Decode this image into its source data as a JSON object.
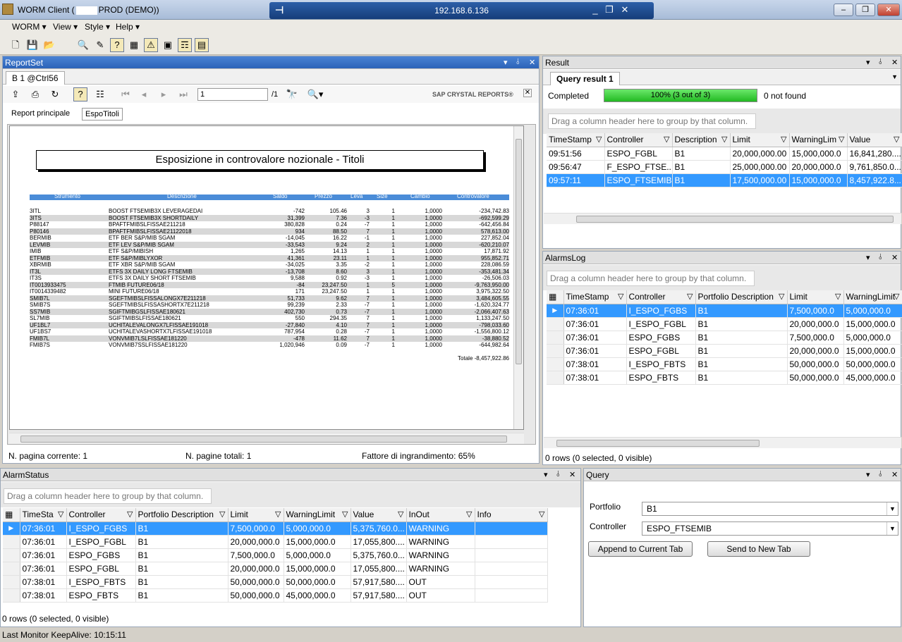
{
  "window": {
    "title": "WORM Client (",
    "title_suffix": "PROD (DEMO))",
    "rdp_ip": "192.168.6.136"
  },
  "menu": [
    "WORM",
    "View",
    "Style",
    "Help"
  ],
  "reportset": {
    "title": "ReportSet",
    "tab": "B 1 @Ctrl56",
    "page_input": "1",
    "page_total": "/1",
    "brand": "SAP CRYSTAL REPORTS®",
    "subtabs": [
      "Report principale",
      "EspoTitoli"
    ],
    "report_title": "Esposizione in controvalore nozionale    - Titoli",
    "columns": [
      "Strumento",
      "Descrizione",
      "Saldo",
      "Prezzo",
      "Leva",
      "Size",
      "Cambio",
      "Controvalore"
    ],
    "rows": [
      [
        "3ITL",
        "BOOST FTSEMIB3X LEVERAGEDAI",
        "-742",
        "105.46",
        "3",
        "1",
        "1,0000",
        "-234,742.83"
      ],
      [
        "3ITS",
        "BOOST FTSEMIB3X SHORTDAILY",
        "31,399",
        "7.36",
        "-3",
        "1",
        "1,0000",
        "-692,599.29"
      ],
      [
        "P88147",
        "BPAFTFMIBSLFISSAE211218",
        "380,828",
        "0.24",
        "-7",
        "1",
        "1,0000",
        "-642,456.84"
      ],
      [
        "P80146",
        "BPAFTFMIBSLFISSAE21122018",
        "934",
        "88.50",
        "7",
        "1",
        "1,0000",
        "578,613.00"
      ],
      [
        "BERMIB",
        "ETF BER S&P/MIB SGAM",
        "-14,045",
        "16.22",
        "-1",
        "1",
        "1,0000",
        "227,852.04"
      ],
      [
        "LEVMIB",
        "ETF LEV S&P/MIB SGAM",
        "-33,543",
        "9.24",
        "2",
        "1",
        "1,0000",
        "-620,210.07"
      ],
      [
        "IMIB",
        "ETF S&P/MIBISH",
        "1,265",
        "14.13",
        "1",
        "1",
        "1,0000",
        "17,871.92"
      ],
      [
        "ETFMIB",
        "ETF S&P/MIBLYXOR",
        "41,361",
        "23.11",
        "1",
        "1",
        "1,0000",
        "955,852.71"
      ],
      [
        "XBRMIB",
        "ETF XBR S&P/MIB SGAM",
        "-34,025",
        "3.35",
        "-2",
        "1",
        "1,0000",
        "228,086.59"
      ],
      [
        "IT3L",
        "ETFS 3X DAILY LONG FTSEMIB",
        "-13,708",
        "8.60",
        "3",
        "1",
        "1,0000",
        "-353,481.34"
      ],
      [
        "IT3S",
        "ETFS 3X DAILY SHORT FTSEMIB",
        "9,588",
        "0.92",
        "-3",
        "1",
        "1,0000",
        "-26,506.03"
      ],
      [
        "IT0013933475",
        "FTMIB FUTURE06/18",
        "-84",
        "23,247.50",
        "1",
        "5",
        "1,0000",
        "-9,763,950.00"
      ],
      [
        "IT0014339482",
        "MINI FUTURE06/18",
        "171",
        "23,247.50",
        "1",
        "1",
        "1,0000",
        "3,975,322.50"
      ],
      [
        "SMIB7L",
        "SGEFTMIBSLFISSALONGX7E211218",
        "51,733",
        "9.62",
        "7",
        "1",
        "1,0000",
        "3,484,605.55"
      ],
      [
        "SMIB7S",
        "SGEFTMIBSLFISSASHORTX7E211218",
        "99,239",
        "2.33",
        "-7",
        "1",
        "1,0000",
        "-1,620,324.77"
      ],
      [
        "SS7MIB",
        "SGIFTMIBGSLFISSAE180621",
        "402,730",
        "0.73",
        "-7",
        "1",
        "1,0000",
        "-2,066,407.63"
      ],
      [
        "SL7MIB",
        "SGIFTMIBSLFISSAE180621",
        "550",
        "294.35",
        "7",
        "1",
        "1,0000",
        "1,133,247.50"
      ],
      [
        "UF1BL7",
        "UCHITALEVALONGX7LFISSAE191018",
        "-27,840",
        "4.10",
        "7",
        "1",
        "1,0000",
        "-798,033.60"
      ],
      [
        "UF1BS7",
        "UCHITALEVASHORTX7LFISSAE191018",
        "787,954",
        "0.28",
        "-7",
        "1",
        "1,0000",
        "-1,556,800.12"
      ],
      [
        "FMIB7L",
        "VONVMIB7LSLFISSAE181220",
        "-478",
        "11.62",
        "7",
        "1",
        "1,0000",
        "-38,880.52"
      ],
      [
        "FMIB7S",
        "VONVMIB7SSLFISSAE181220",
        "1,020,946",
        "0.09",
        "-7",
        "1",
        "1,0000",
        "-644,982.64"
      ]
    ],
    "total": "Totale -8,457,922.86",
    "status": {
      "page": "N. pagina corrente: 1",
      "pages": "N. pagine totali: 1",
      "zoom": "Fattore di ingrandimento: 65%"
    }
  },
  "result": {
    "title": "Result",
    "tab": "Query result 1",
    "completed": "Completed",
    "progress": "100% (3 out of 3)",
    "progress_value": 1.0,
    "not_found": "0 not found",
    "group_hint": "Drag a column header here to group by that column.",
    "columns": [
      "TimeStamp",
      "Controller",
      "Description",
      "Limit",
      "WarningLim",
      "Value"
    ],
    "rows": [
      [
        "09:51:56",
        "ESPO_FGBL",
        "B1",
        "20,000,000.00",
        "15,000,000.0",
        "16,841,280...."
      ],
      [
        "09:56:47",
        "F_ESPO_FTSE...",
        "B1",
        "25,000,000.00",
        "20,000,000.0",
        "9,761,850.0..."
      ],
      [
        "09:57:11",
        "ESPO_FTSEMIB",
        "B1",
        "17,500,000.00",
        "15,000,000.0",
        "8,457,922.8..."
      ]
    ]
  },
  "alarmslog": {
    "title": "AlarmsLog",
    "group_hint": "Drag a column header here to group by that column.",
    "columns": [
      "TimeStamp",
      "Controller",
      "Portfolio Description",
      "Limit",
      "WarningLimit"
    ],
    "rows": [
      [
        "07:36:01",
        "I_ESPO_FGBS",
        "B1",
        "7,500,000.0",
        "5,000,000.0"
      ],
      [
        "07:36:01",
        "I_ESPO_FGBL",
        "B1",
        "20,000,000.0",
        "15,000,000.0"
      ],
      [
        "07:36:01",
        "ESPO_FGBS",
        "B1",
        "7,500,000.0",
        "5,000,000.0"
      ],
      [
        "07:36:01",
        "ESPO_FGBL",
        "B1",
        "20,000,000.0",
        "15,000,000.0"
      ],
      [
        "07:38:01",
        "I_ESPO_FBTS",
        "B1",
        "50,000,000.0",
        "50,000,000.0"
      ],
      [
        "07:38:01",
        "ESPO_FBTS",
        "B1",
        "50,000,000.0",
        "45,000,000.0"
      ]
    ],
    "status": "0 rows (0 selected, 0 visible)"
  },
  "alarmstatus": {
    "title": "AlarmStatus",
    "group_hint": "Drag a column header here to group by that column.",
    "columns": [
      "TimeSta",
      "Controller",
      "Portfolio Description",
      "Limit",
      "WarningLimit",
      "Value",
      "InOut",
      "Info"
    ],
    "rows": [
      [
        "07:36:01",
        "I_ESPO_FGBS",
        "B1",
        "7,500,000.0",
        "5,000,000.0",
        "5,375,760.0...",
        "WARNING",
        ""
      ],
      [
        "07:36:01",
        "I_ESPO_FGBL",
        "B1",
        "20,000,000.0",
        "15,000,000.0",
        "17,055,800....",
        "WARNING",
        ""
      ],
      [
        "07:36:01",
        "ESPO_FGBS",
        "B1",
        "7,500,000.0",
        "5,000,000.0",
        "5,375,760.0...",
        "WARNING",
        ""
      ],
      [
        "07:36:01",
        "ESPO_FGBL",
        "B1",
        "20,000,000.0",
        "15,000,000.0",
        "17,055,800....",
        "WARNING",
        ""
      ],
      [
        "07:38:01",
        "I_ESPO_FBTS",
        "B1",
        "50,000,000.0",
        "50,000,000.0",
        "57,917,580....",
        "OUT",
        ""
      ],
      [
        "07:38:01",
        "ESPO_FBTS",
        "B1",
        "50,000,000.0",
        "45,000,000.0",
        "57,917,580....",
        "OUT",
        ""
      ]
    ],
    "status": "0 rows (0 selected, 0 visible)"
  },
  "query": {
    "title": "Query",
    "portfolio_label": "Portfolio",
    "portfolio_value": "B1",
    "controller_label": "Controller",
    "controller_value": "ESPO_FTSEMIB",
    "append_btn": "Append to Current Tab",
    "send_btn": "Send to New Tab"
  },
  "footer": "Last Monitor KeepAlive: 10:15:11",
  "colors": {
    "selection": "#3399ff",
    "panel_header_active": "#2c63b8",
    "progress": "#22b922"
  }
}
